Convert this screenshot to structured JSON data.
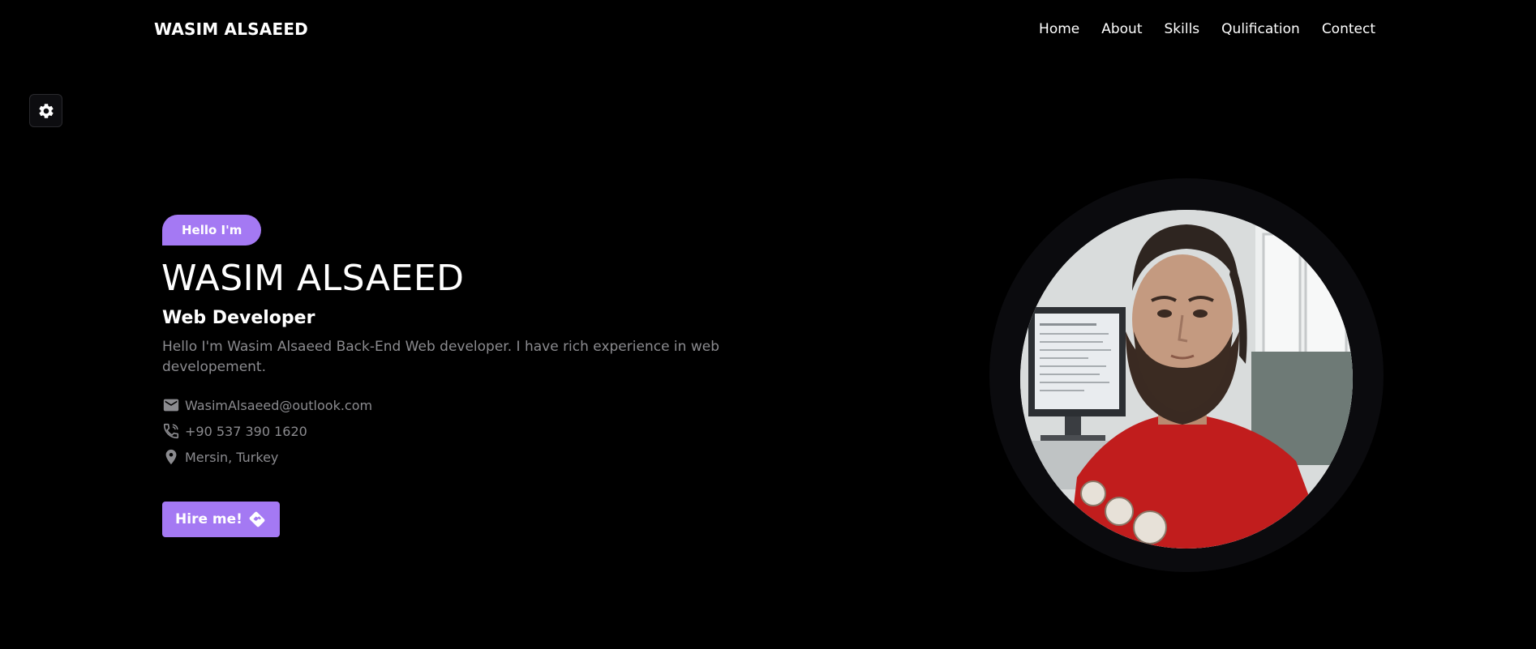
{
  "header": {
    "brand": "WASIM ALSAEED",
    "nav": [
      "Home",
      "About",
      "Skills",
      "Qulification",
      "Contect"
    ]
  },
  "settings": {
    "icon": "gear-icon"
  },
  "hero": {
    "greeting": "Hello I'm",
    "name": "WASIM ALSAEED",
    "role": "Web Developer",
    "description": "Hello I'm Wasim Alsaeed Back-End Web developer. I have rich experience in web developement.",
    "contacts": [
      {
        "icon": "mail-icon",
        "text": "WasimAlsaeed@outlook.com"
      },
      {
        "icon": "phone-icon",
        "text": "+90 537 390 1620"
      },
      {
        "icon": "location-pin-icon",
        "text": "Mersin, Turkey"
      }
    ],
    "hire_label": "Hire me!",
    "hire_icon": "handshake-icon"
  },
  "colors": {
    "background": "#000000",
    "accent": "#a479f3",
    "muted_text": "#8b8b8f",
    "ring": "#0b0b0e"
  }
}
